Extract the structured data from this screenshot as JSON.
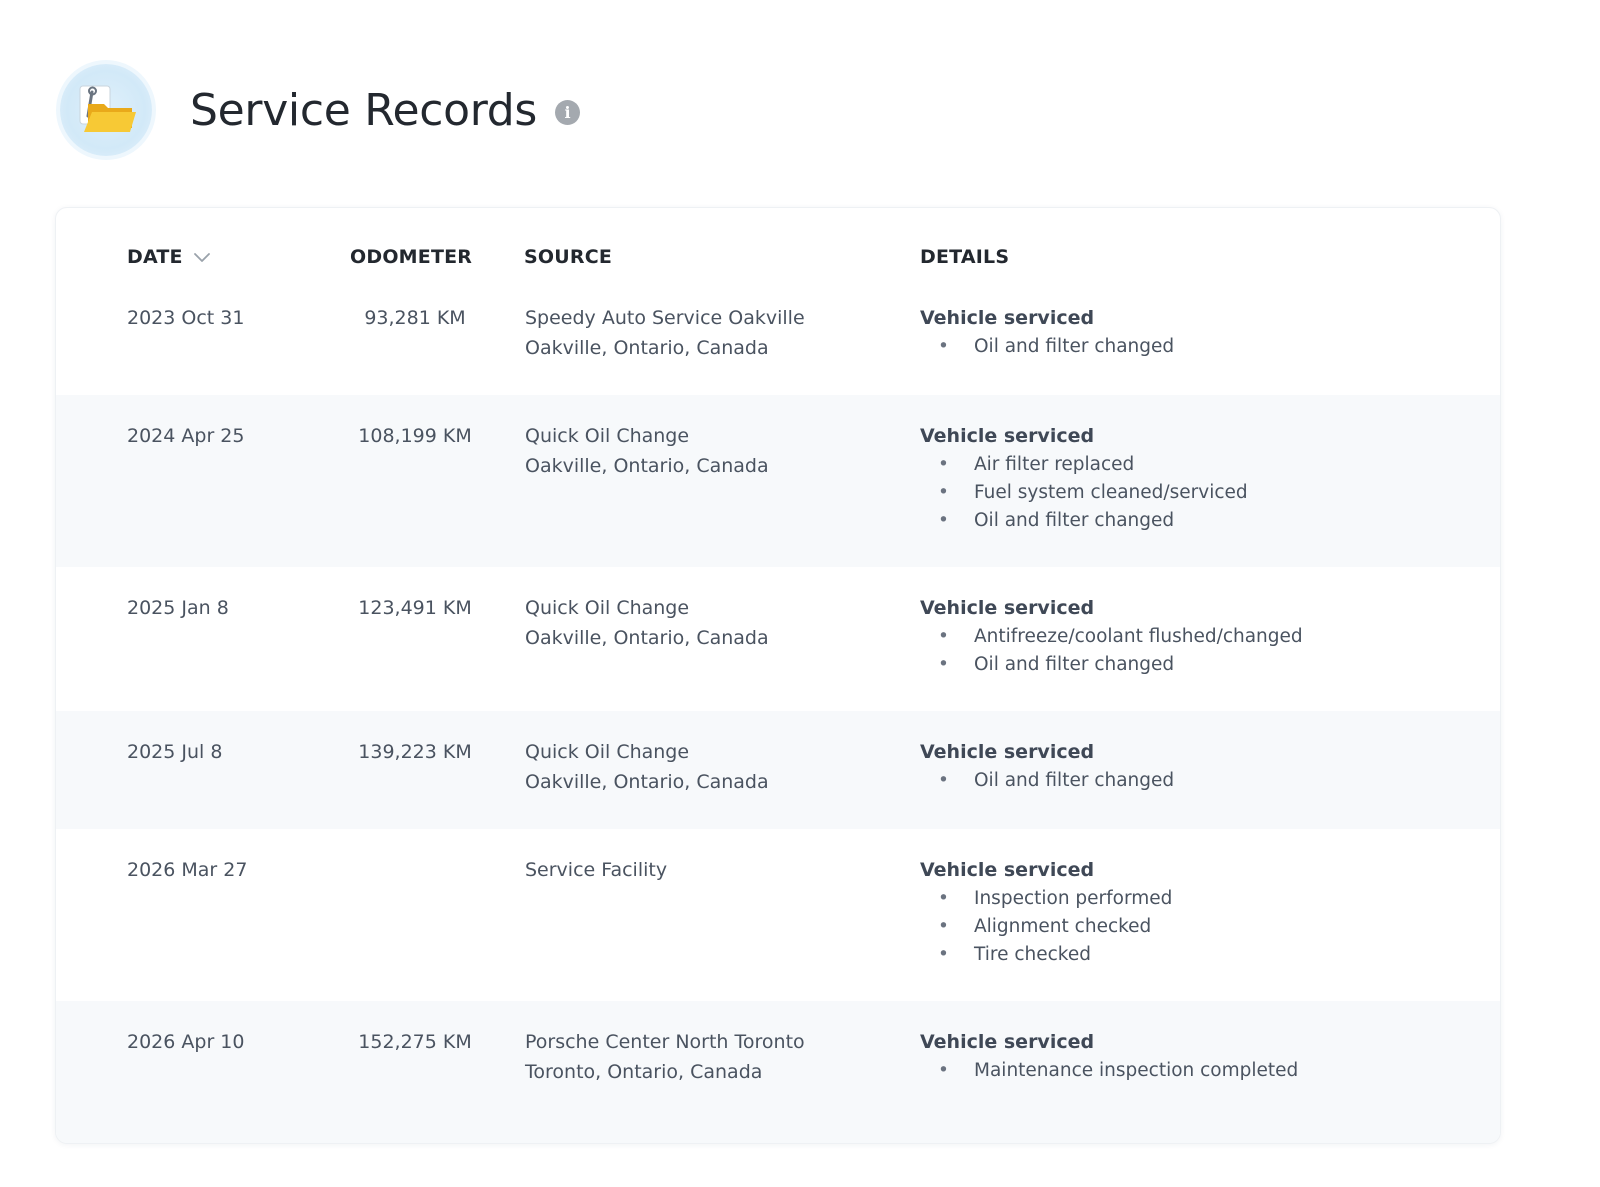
{
  "header": {
    "title": "Service Records",
    "icon": "folder-wrench-icon",
    "info_icon": "info-icon",
    "info_glyph": "i"
  },
  "table": {
    "columns": {
      "date": "DATE",
      "odometer": "ODOMETER",
      "source": "SOURCE",
      "details": "DETAILS"
    },
    "sort": {
      "column": "date",
      "direction": "descending-indicator",
      "icon": "chevron-down-icon"
    },
    "rows": [
      {
        "date": "2023 Oct 31",
        "odometer": "93,281 KM",
        "source_name": "Speedy Auto Service Oakville",
        "source_location": "Oakville, Ontario, Canada",
        "details_title": "Vehicle serviced",
        "details_items": [
          "Oil and filter changed"
        ]
      },
      {
        "date": "2024 Apr 25",
        "odometer": "108,199 KM",
        "source_name": "Quick Oil Change",
        "source_location": "Oakville, Ontario, Canada",
        "details_title": "Vehicle serviced",
        "details_items": [
          "Air filter replaced",
          "Fuel system cleaned/serviced",
          "Oil and filter changed"
        ]
      },
      {
        "date": "2025 Jan 8",
        "odometer": "123,491 KM",
        "source_name": "Quick Oil Change",
        "source_location": "Oakville, Ontario, Canada",
        "details_title": "Vehicle serviced",
        "details_items": [
          "Antifreeze/coolant flushed/changed",
          "Oil and filter changed"
        ]
      },
      {
        "date": "2025 Jul 8",
        "odometer": "139,223 KM",
        "source_name": "Quick Oil Change",
        "source_location": "Oakville, Ontario, Canada",
        "details_title": "Vehicle serviced",
        "details_items": [
          "Oil and filter changed"
        ]
      },
      {
        "date": "2026 Mar 27",
        "odometer": "",
        "source_name": "Service Facility",
        "source_location": "",
        "details_title": "Vehicle serviced",
        "details_items": [
          "Inspection performed",
          "Alignment checked",
          "Tire checked"
        ]
      },
      {
        "date": "2026 Apr 10",
        "odometer": "152,275 KM",
        "source_name": "Porsche Center North Toronto",
        "source_location": "Toronto, Ontario, Canada",
        "details_title": "Vehicle serviced",
        "details_items": [
          "Maintenance inspection completed"
        ]
      }
    ]
  },
  "colors": {
    "title": "#23282f",
    "text": "#4a5360",
    "row_alt_bg": "#f7f9fb",
    "icon_bg": "#d2e9f8",
    "folder": "#f6c431"
  }
}
